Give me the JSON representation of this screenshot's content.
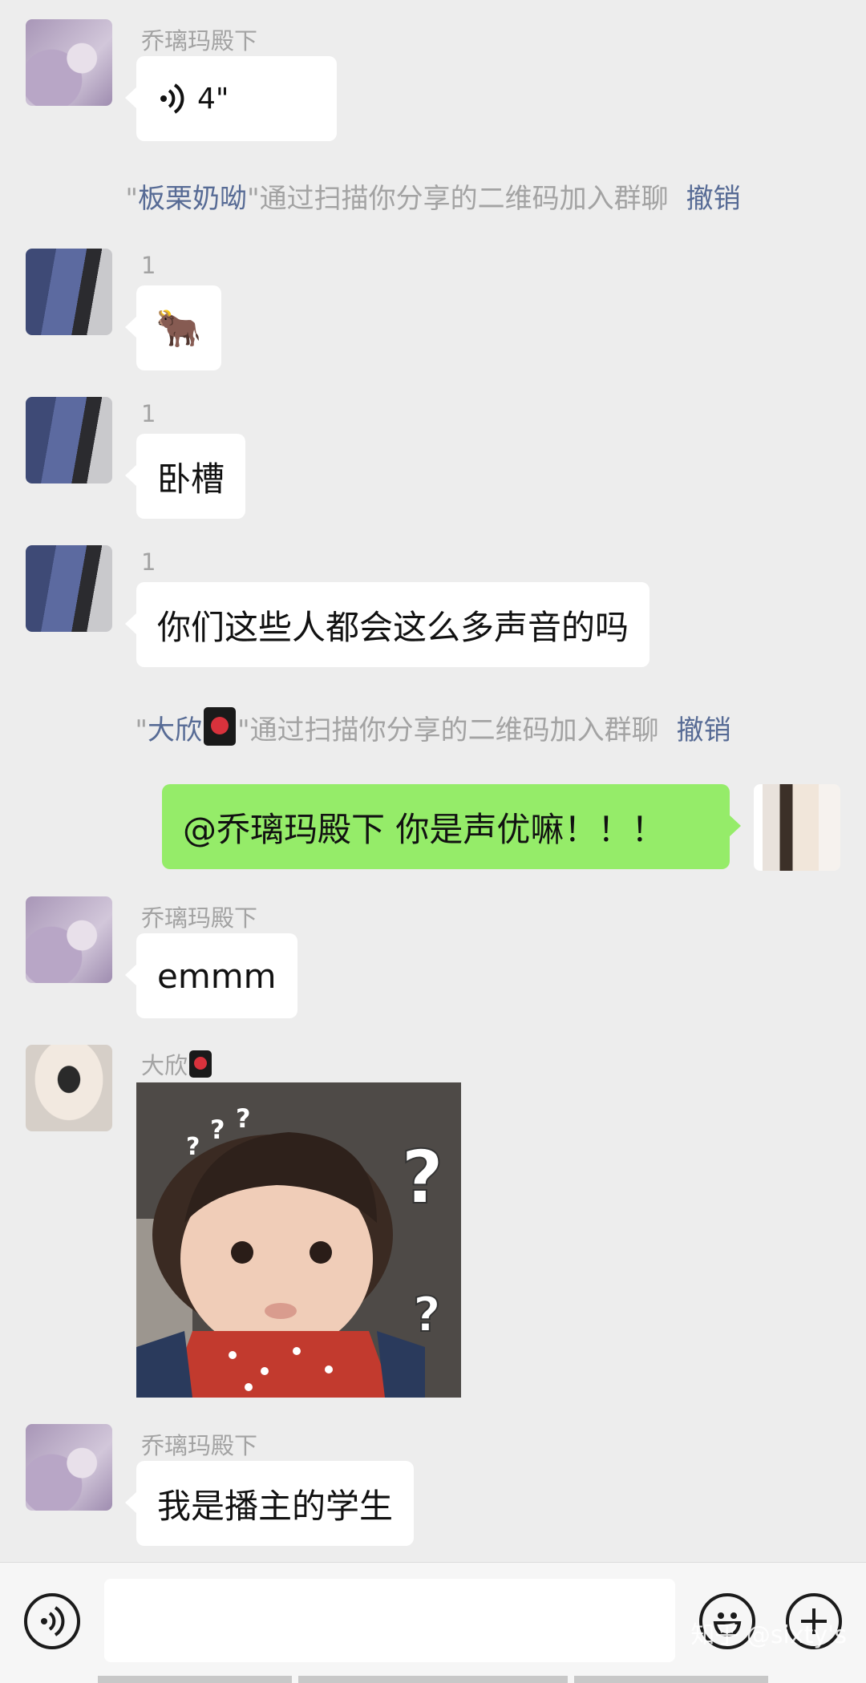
{
  "messages": {
    "m1": {
      "sender": "乔璃玛殿下",
      "voice_duration": "4\""
    },
    "sys1": {
      "quote_open": "\"",
      "name": "板栗奶呦",
      "text": "\"通过扫描你分享的二维码加入群聊",
      "undo": "撤销"
    },
    "m2": {
      "sender": "1",
      "emoji": "🐂"
    },
    "m3": {
      "sender": "1",
      "text": "卧槽"
    },
    "m4": {
      "sender": "1",
      "text": "你们这些人都会这么多声音的吗"
    },
    "sys2": {
      "quote_open": "\"",
      "name": "大欣",
      "text": "\"通过扫描你分享的二维码加入群聊",
      "undo": "撤销"
    },
    "m5": {
      "text": "@乔璃玛殿下  你是声优嘛！！！"
    },
    "m6": {
      "sender": "乔璃玛殿下",
      "text": "emmm"
    },
    "m7": {
      "sender": "大欣",
      "sticker_marks": [
        "?",
        "?",
        "?",
        "?",
        "?"
      ]
    },
    "m8": {
      "sender": "乔璃玛殿下",
      "text": "我是播主的学生"
    }
  },
  "input_bar": {
    "value": ""
  },
  "watermark": "知乎 @sixty's",
  "colors": {
    "background": "#ededed",
    "bubble_in": "#ffffff",
    "bubble_out": "#95ec69",
    "link": "#576b95",
    "meta": "#a3a3a3"
  },
  "icons": [
    "voice-icon",
    "emoji-icon",
    "plus-icon",
    "flag-emoji-icon",
    "speaker-icon"
  ]
}
